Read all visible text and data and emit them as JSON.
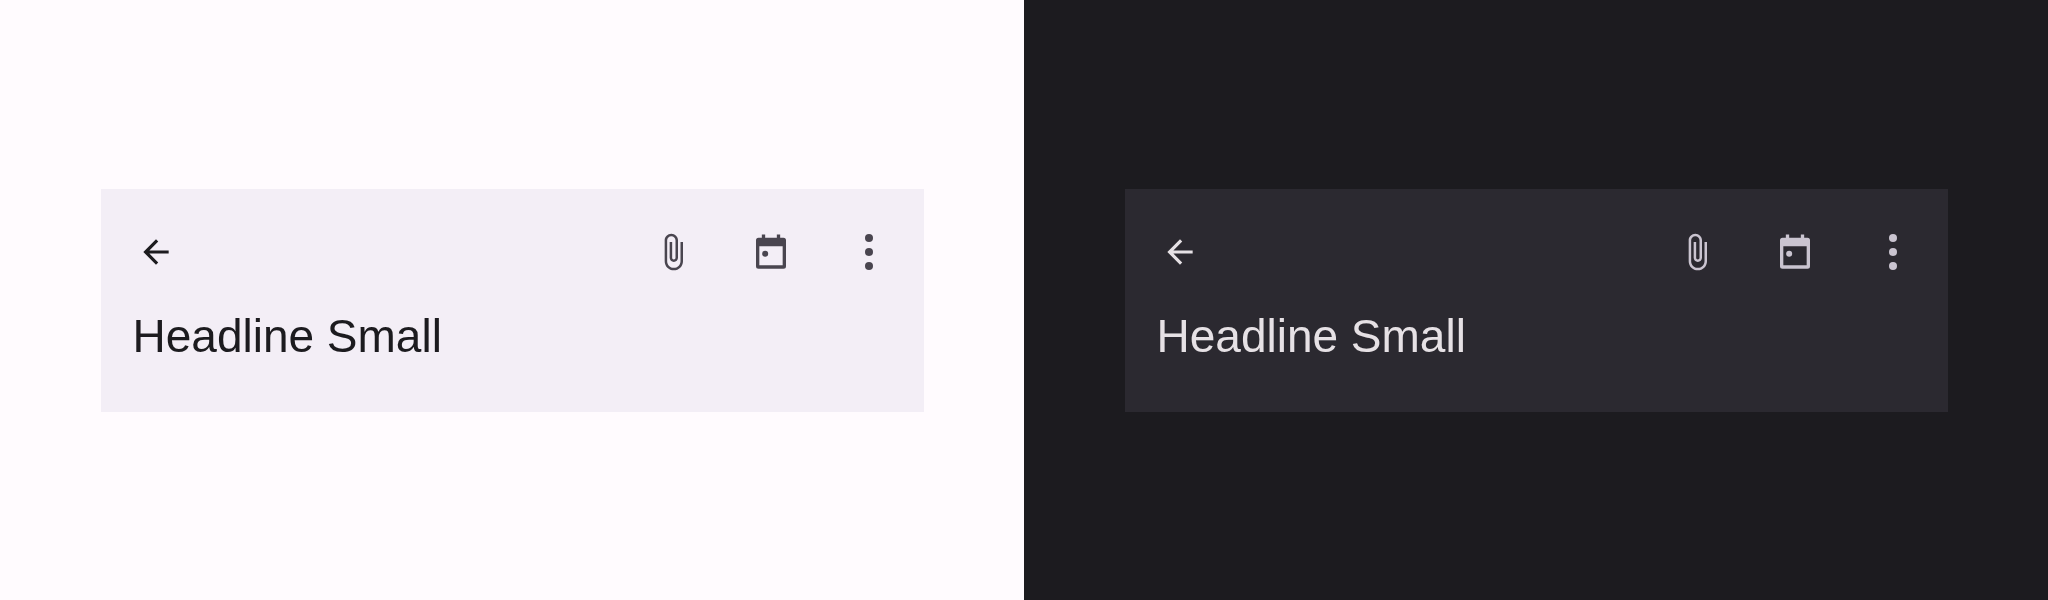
{
  "panels": [
    {
      "kind": "light",
      "title": "Headline Small"
    },
    {
      "kind": "dark",
      "title": "Headline Small"
    }
  ]
}
